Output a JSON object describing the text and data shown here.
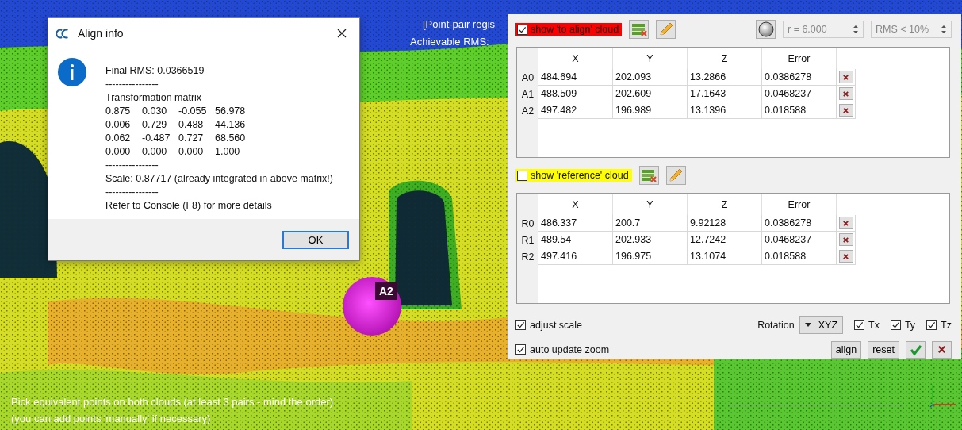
{
  "viewport": {
    "overlay_lines": [
      "[Point-pair regis",
      "Achievable RMS:"
    ],
    "point_label": "A2",
    "instructions": [
      "Pick equivalent points on both clouds (at least 3 pairs - mind the order)",
      "(you can add points 'manually' if necessary)"
    ]
  },
  "dialog": {
    "title": "Align info",
    "content": [
      {
        "kind": "text",
        "text": "Final RMS: 0.0366519"
      },
      {
        "kind": "text",
        "text": "----------------"
      },
      {
        "kind": "text",
        "text": "Transformation matrix"
      },
      {
        "kind": "matrix",
        "rows": [
          [
            "0.875",
            "0.030",
            "-0.055",
            "56.978"
          ],
          [
            "0.006",
            "0.729",
            "0.488",
            "44.136"
          ],
          [
            "0.062",
            "-0.487",
            "0.727",
            "68.560"
          ],
          [
            "0.000",
            "0.000",
            "0.000",
            "1.000"
          ]
        ]
      },
      {
        "kind": "text",
        "text": "----------------"
      },
      {
        "kind": "text",
        "text": "Scale: 0.87717 (already integrated in above matrix!)"
      },
      {
        "kind": "text",
        "text": "----------------"
      },
      {
        "kind": "text",
        "text": "Refer to Console (F8) for more details"
      }
    ],
    "button": "OK"
  },
  "panel": {
    "radius": "r = 6.000",
    "rms_filter": "RMS < 10%",
    "clouds": [
      {
        "label": "show 'to align' cloud",
        "checked": true,
        "color": "#ff0000",
        "columns": [
          "X",
          "Y",
          "Z",
          "Error"
        ],
        "rows": [
          {
            "name": "A0",
            "values": [
              "484.694",
              "202.093",
              "13.2866",
              "0.0386278"
            ]
          },
          {
            "name": "A1",
            "values": [
              "488.509",
              "202.609",
              "17.1643",
              "0.0468237"
            ]
          },
          {
            "name": "A2",
            "values": [
              "497.482",
              "196.989",
              "13.1396",
              "0.018588"
            ]
          }
        ]
      },
      {
        "label": "show 'reference' cloud",
        "checked": false,
        "color": "#ffff00",
        "columns": [
          "X",
          "Y",
          "Z",
          "Error"
        ],
        "rows": [
          {
            "name": "R0",
            "values": [
              "486.337",
              "200.7",
              "9.92128",
              "0.0386278"
            ]
          },
          {
            "name": "R1",
            "values": [
              "489.54",
              "202.933",
              "12.7242",
              "0.0468237"
            ]
          },
          {
            "name": "R2",
            "values": [
              "497.416",
              "196.975",
              "13.1074",
              "0.018588"
            ]
          }
        ]
      }
    ],
    "adjust_scale": {
      "label": "adjust scale",
      "checked": true
    },
    "auto_update_zoom": {
      "label": "auto update zoom",
      "checked": true
    },
    "rotation": {
      "label": "Rotation",
      "value": "XYZ"
    },
    "translations": [
      {
        "label": "Tx",
        "checked": true
      },
      {
        "label": "Ty",
        "checked": true
      },
      {
        "label": "Tz",
        "checked": true
      }
    ],
    "buttons": [
      "align",
      "reset"
    ]
  }
}
